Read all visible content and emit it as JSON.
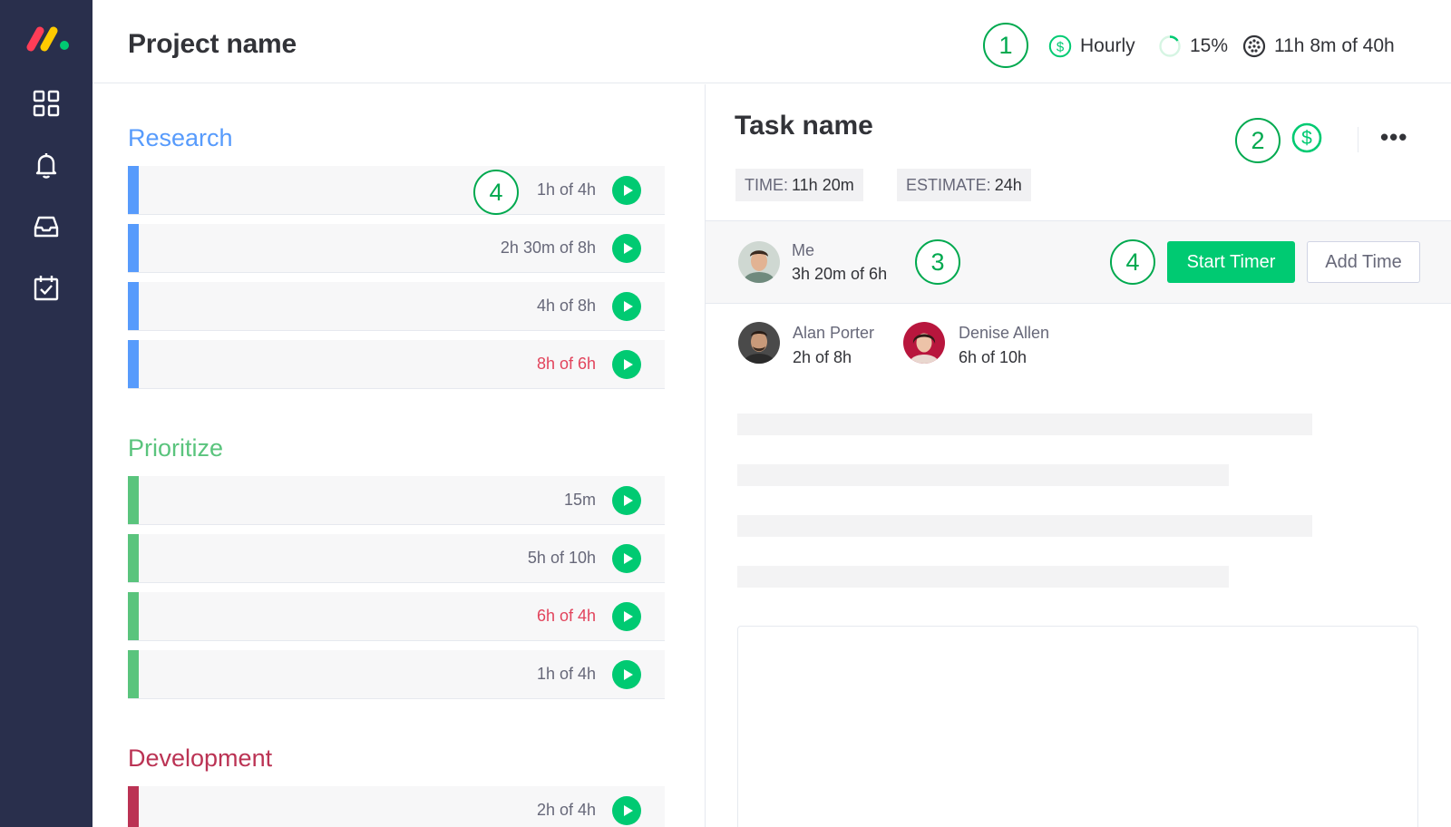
{
  "header": {
    "project_title": "Project name",
    "billing_label": "Hourly",
    "progress_label": "15%",
    "progress_value": 0.15,
    "time_summary": "11h 8m of 40h"
  },
  "callouts": [
    "1",
    "2",
    "3",
    "4"
  ],
  "groups": [
    {
      "title": "Research",
      "color": "#579bfc",
      "tasks": [
        {
          "time": "1h of 4h",
          "over": false
        },
        {
          "time": "2h 30m of 8h",
          "over": false
        },
        {
          "time": "4h of 8h",
          "over": false
        },
        {
          "time": "8h of 6h",
          "over": true
        }
      ]
    },
    {
      "title": "Prioritize",
      "color": "#5ac47d",
      "tasks": [
        {
          "time": "15m",
          "over": false
        },
        {
          "time": "5h of 10h",
          "over": false
        },
        {
          "time": "6h of 4h",
          "over": true
        },
        {
          "time": "1h of 4h",
          "over": false
        }
      ]
    },
    {
      "title": "Development",
      "color": "#bb3354",
      "tasks": [
        {
          "time": "2h of 4h",
          "over": false
        }
      ]
    }
  ],
  "task": {
    "title": "Task name",
    "time_label": "TIME:",
    "time_value": "11h 20m",
    "estimate_label": "ESTIMATE:",
    "estimate_value": "24h",
    "more_label": "•••"
  },
  "me": {
    "name": "Me",
    "time": "3h 20m of 6h"
  },
  "actions": {
    "start_timer": "Start Timer",
    "add_time": "Add Time"
  },
  "people": [
    {
      "name": "Alan Porter",
      "time": "2h of 8h"
    },
    {
      "name": "Denise Allen",
      "time": "6h of 10h"
    }
  ],
  "colors": {
    "sidebar": "#292f4c",
    "accent_green": "#00ca72",
    "callout_green": "#00a94f",
    "over_red": "#e2445c"
  }
}
